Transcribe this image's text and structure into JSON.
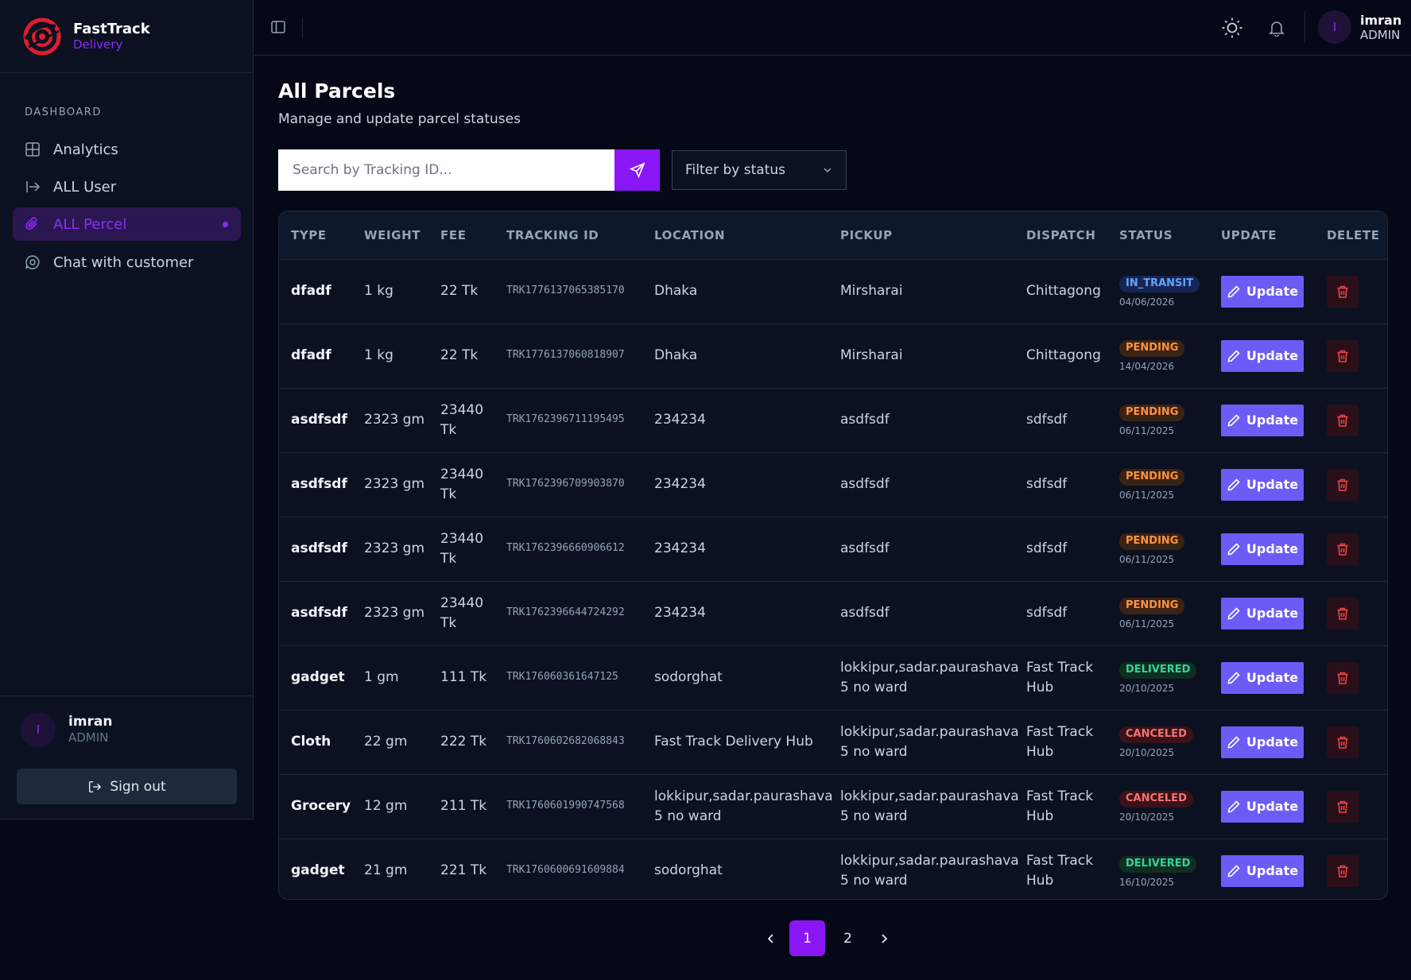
{
  "brand": {
    "name": "FastTrack",
    "sub": "Delivery"
  },
  "sidebar": {
    "section_label": "DASHBOARD",
    "items": [
      {
        "label": "Analytics",
        "icon": "grid-icon"
      },
      {
        "label": "ALL User",
        "icon": "arrow-right-bar-icon"
      },
      {
        "label": "ALL Percel",
        "icon": "paperclip-icon",
        "active": true
      },
      {
        "label": "Chat with customer",
        "icon": "chat-icon"
      }
    ],
    "user": {
      "initial": "I",
      "name": "imran",
      "role": "ADMIN"
    },
    "signout_label": "Sign out"
  },
  "header": {
    "user": {
      "initial": "I",
      "name": "imran",
      "role": "ADMIN"
    }
  },
  "main": {
    "title": "All Parcels",
    "subtitle": "Manage and update parcel statuses",
    "search_placeholder": "Search by Tracking ID...",
    "filter_label": "Filter by status"
  },
  "table": {
    "headers": [
      "TYPE",
      "WEIGHT",
      "FEE",
      "TRACKING ID",
      "LOCATION",
      "PICKUP",
      "DISPATCH",
      "STATUS",
      "UPDATE",
      "DELETE"
    ],
    "update_label": "Update",
    "rows": [
      {
        "type": "dfadf",
        "weight": "1 kg",
        "fee": "22 Tk",
        "tracking": "TRK1776137065385170",
        "location": "Dhaka",
        "pickup": "Mirsharai",
        "dispatch": "Chittagong",
        "status": "IN_TRANSIT",
        "date": "04/06/2026"
      },
      {
        "type": "dfadf",
        "weight": "1 kg",
        "fee": "22 Tk",
        "tracking": "TRK1776137060818907",
        "location": "Dhaka",
        "pickup": "Mirsharai",
        "dispatch": "Chittagong",
        "status": "PENDING",
        "date": "14/04/2026"
      },
      {
        "type": "asdfsdf",
        "weight": "2323 gm",
        "fee": "23440 Tk",
        "tracking": "TRK1762396711195495",
        "location": "234234",
        "pickup": "asdfsdf",
        "dispatch": "sdfsdf",
        "status": "PENDING",
        "date": "06/11/2025"
      },
      {
        "type": "asdfsdf",
        "weight": "2323 gm",
        "fee": "23440 Tk",
        "tracking": "TRK1762396709903870",
        "location": "234234",
        "pickup": "asdfsdf",
        "dispatch": "sdfsdf",
        "status": "PENDING",
        "date": "06/11/2025"
      },
      {
        "type": "asdfsdf",
        "weight": "2323 gm",
        "fee": "23440 Tk",
        "tracking": "TRK1762396660906612",
        "location": "234234",
        "pickup": "asdfsdf",
        "dispatch": "sdfsdf",
        "status": "PENDING",
        "date": "06/11/2025"
      },
      {
        "type": "asdfsdf",
        "weight": "2323 gm",
        "fee": "23440 Tk",
        "tracking": "TRK1762396644724292",
        "location": "234234",
        "pickup": "asdfsdf",
        "dispatch": "sdfsdf",
        "status": "PENDING",
        "date": "06/11/2025"
      },
      {
        "type": "gadget",
        "weight": "1 gm",
        "fee": "111 Tk",
        "tracking": "TRK176060361647125",
        "location": "sodorghat",
        "pickup": "lokkipur,sadar.paurashava 5 no ward",
        "dispatch": "Fast Track Hub",
        "status": "DELIVERED",
        "date": "20/10/2025"
      },
      {
        "type": "Cloth",
        "weight": "22 gm",
        "fee": "222 Tk",
        "tracking": "TRK1760602682068843",
        "location": "Fast Track Delivery Hub",
        "pickup": "lokkipur,sadar.paurashava 5 no ward",
        "dispatch": "Fast Track Hub",
        "status": "CANCELED",
        "date": "20/10/2025"
      },
      {
        "type": "Grocery",
        "weight": "12 gm",
        "fee": "211 Tk",
        "tracking": "TRK1760601990747568",
        "location": "lokkipur,sadar.paurashava 5 no ward",
        "pickup": "lokkipur,sadar.paurashava 5 no ward",
        "dispatch": "Fast Track Hub",
        "status": "CANCELED",
        "date": "20/10/2025"
      },
      {
        "type": "gadget",
        "weight": "21 gm",
        "fee": "221 Tk",
        "tracking": "TRK1760600691609884",
        "location": "sodorghat",
        "pickup": "lokkipur,sadar.paurashava 5 no ward",
        "dispatch": "Fast Track Hub",
        "status": "DELIVERED",
        "date": "16/10/2025"
      }
    ]
  },
  "pagination": {
    "pages": [
      "1",
      "2"
    ],
    "current": "1"
  },
  "colors": {
    "accent": "#8b16f5",
    "update_button": "#6b5cf6",
    "background": "#050816",
    "logo": "#e11d2e"
  }
}
